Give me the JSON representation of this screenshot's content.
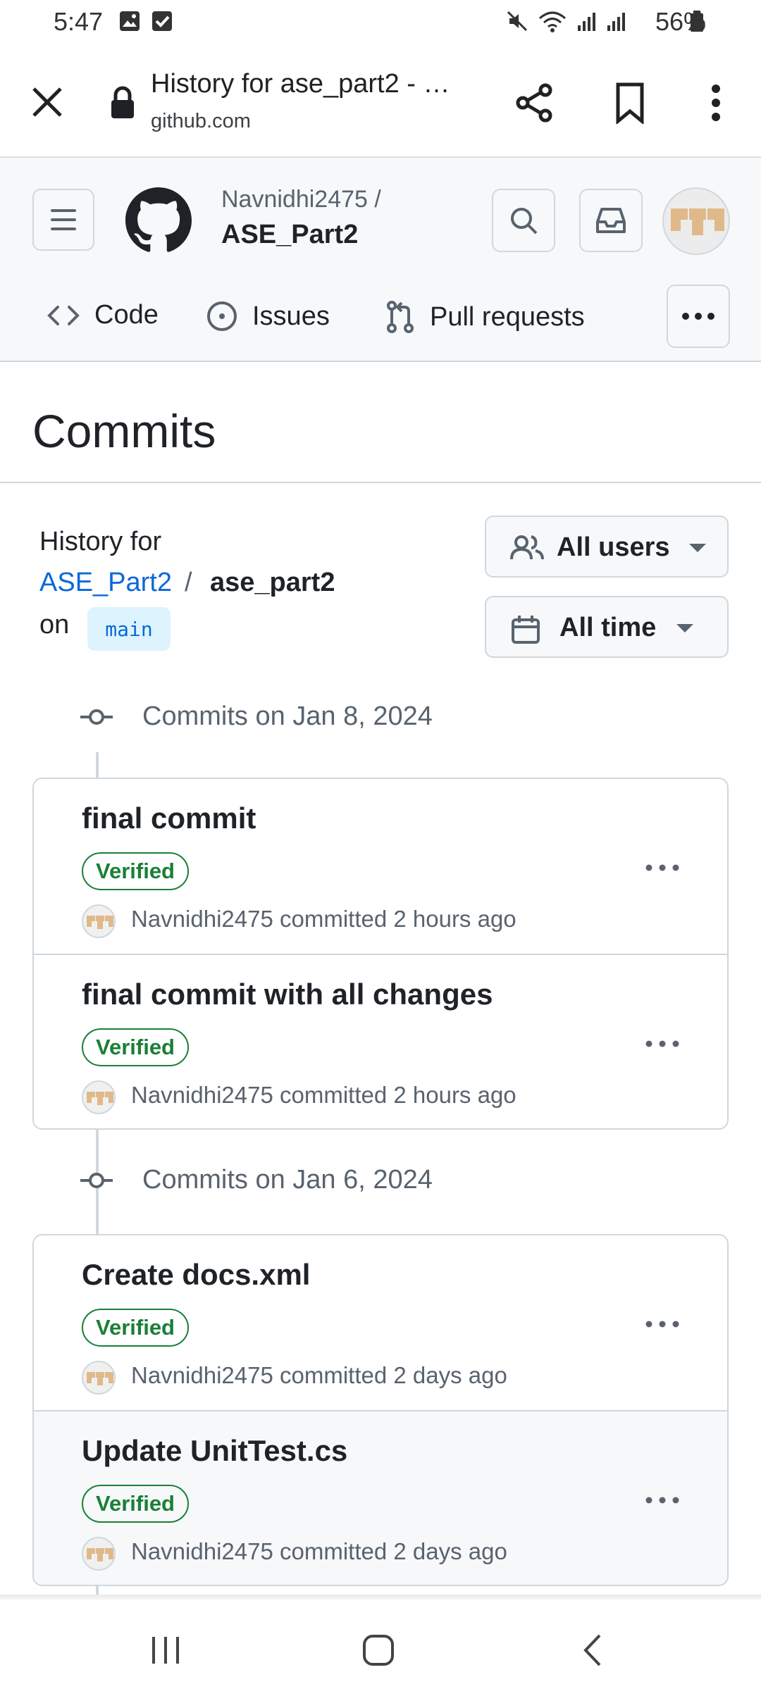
{
  "status_bar": {
    "time": "5:47",
    "battery": "56%"
  },
  "browser": {
    "page_title": "History for ase_part2 - …",
    "url": "github.com"
  },
  "github": {
    "owner": "Navnidhi2475 /",
    "repo": "ASE_Part2",
    "nav": {
      "code": "Code",
      "issues": "Issues",
      "pull_requests": "Pull requests"
    }
  },
  "page": {
    "title": "Commits",
    "history_for": "History for",
    "repo_link": "ASE_Part2",
    "separator": "/",
    "path": "ase_part2",
    "on": "on",
    "branch": "main"
  },
  "filters": {
    "users": "All users",
    "time": "All time"
  },
  "groups": [
    {
      "heading": "Commits on Jan 8, 2024",
      "commits": [
        {
          "title": "final commit",
          "badge": "Verified",
          "meta": "Navnidhi2475 committed 2 hours ago"
        },
        {
          "title": "final commit with all changes",
          "badge": "Verified",
          "meta": "Navnidhi2475 committed 2 hours ago"
        }
      ]
    },
    {
      "heading": "Commits on Jan 6, 2024",
      "commits": [
        {
          "title": "Create docs.xml",
          "badge": "Verified",
          "meta": "Navnidhi2475 committed 2 days ago"
        },
        {
          "title": "Update UnitTest.cs",
          "badge": "Verified",
          "meta": "Navnidhi2475 committed 2 days ago"
        }
      ]
    }
  ],
  "colors": {
    "link": "#0969da",
    "verified": "#1a7f37",
    "header_bg": "#f6f8fa",
    "border": "#d0d7de"
  }
}
